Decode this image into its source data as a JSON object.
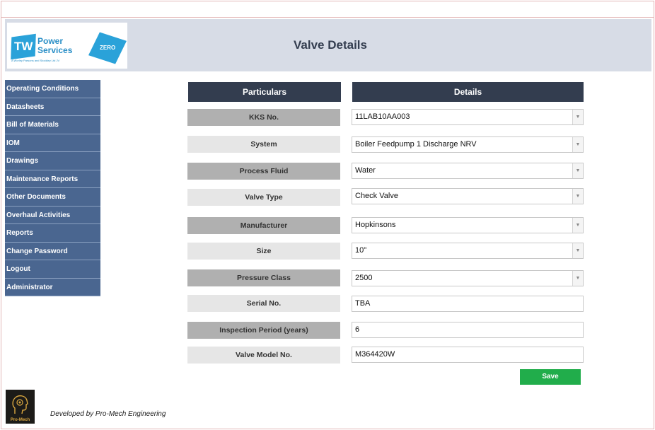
{
  "header": {
    "title": "Valve Details",
    "logo": {
      "mark": "TW",
      "name_line1": "Power",
      "name_line2": "Services",
      "tagline": "A Worley Parsons and Stockley Ltd JV",
      "zero_mark": "ZERO"
    }
  },
  "sidebar": {
    "items": [
      {
        "label": "Operating Conditions"
      },
      {
        "label": "Datasheets"
      },
      {
        "label": "Bill of Materials"
      },
      {
        "label": "IOM"
      },
      {
        "label": "Drawings"
      },
      {
        "label": "Maintenance Reports"
      },
      {
        "label": "Other Documents"
      },
      {
        "label": "Overhaul Activities"
      },
      {
        "label": "Reports"
      },
      {
        "label": "Change Password"
      },
      {
        "label": "Logout"
      },
      {
        "label": "Administrator"
      }
    ]
  },
  "table": {
    "head_particulars": "Particulars",
    "head_details": "Details",
    "rows": [
      {
        "label": "KKS No.",
        "value": "11LAB10AA003"
      },
      {
        "label": "System",
        "value": "Boiler Feedpump 1 Discharge NRV"
      },
      {
        "label": "Process Fluid",
        "value": "Water"
      },
      {
        "label": "Valve Type",
        "value": "Check Valve"
      },
      {
        "label": "Manufacturer",
        "value": "Hopkinsons"
      },
      {
        "label": "Size",
        "value": "10\""
      },
      {
        "label": "Pressure Class",
        "value": "2500"
      },
      {
        "label": "Serial No.",
        "value": "TBA"
      },
      {
        "label": "Inspection Period (years)",
        "value": "6"
      },
      {
        "label": "Valve Model No.",
        "value": "M364420W"
      }
    ]
  },
  "actions": {
    "save_label": "Save"
  },
  "footer": {
    "logo_text": "Pro-Mech",
    "credit": "Developed by Pro-Mech Engineering"
  },
  "colors": {
    "nav": "#4a6690",
    "header_band": "#d7dce6",
    "column_head": "#333d4f",
    "save": "#21ad4b",
    "brand_blue": "#2aa2d9"
  }
}
